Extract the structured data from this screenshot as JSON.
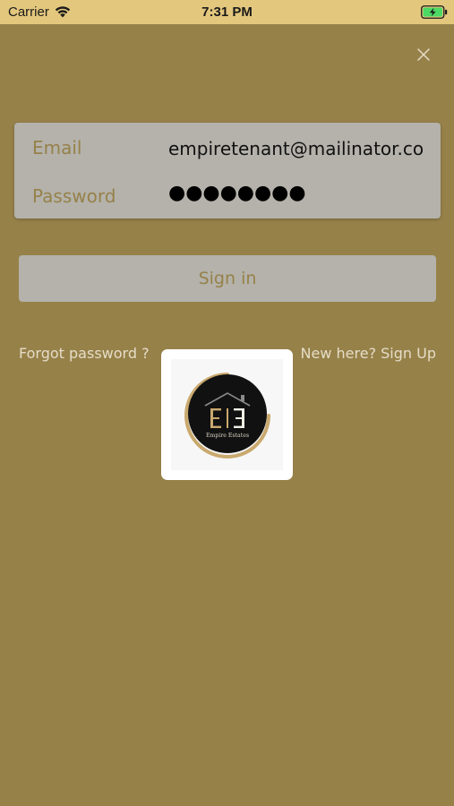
{
  "status_bar": {
    "carrier": "Carrier",
    "time": "7:31 PM",
    "wifi_icon": "wifi-icon",
    "battery_icon": "battery-charging-icon"
  },
  "close_icon": "close-icon",
  "login_form": {
    "email_label": "Email",
    "email_value": "empiretenant@mailinator.com",
    "password_label": "Password",
    "password_masked": "●●●●●●●●"
  },
  "sign_in_label": "Sign in",
  "forgot_password_label": "Forgot password ?",
  "sign_up_label": "New here? Sign Up",
  "logo": {
    "text": "Empire Estates",
    "monogram": "EE"
  },
  "colors": {
    "background": "#968149",
    "status_bar": "#e3c77d",
    "card": "#b4b2ab",
    "accent": "#968149",
    "link_text": "#e6ddc8",
    "logo_gold": "#c9a96e"
  }
}
